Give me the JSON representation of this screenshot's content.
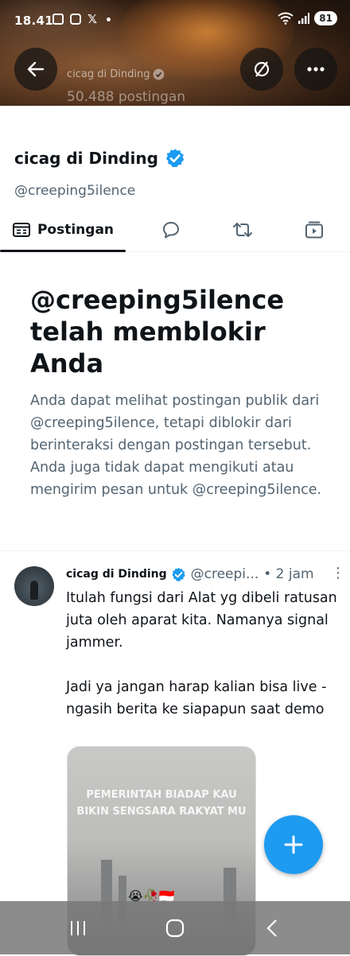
{
  "status_bar": {
    "time": "18.41",
    "x_label": "𝕏",
    "battery": "81"
  },
  "header": {
    "name": "cicag di Dinding",
    "post_count": "50.488 postingan"
  },
  "profile": {
    "name": "cicag di Dinding",
    "handle": "@creeping5ilence"
  },
  "tabs": [
    {
      "label": "Postingan",
      "icon": "posts-icon",
      "active": true
    },
    {
      "label": "",
      "icon": "reply-icon"
    },
    {
      "label": "",
      "icon": "repost-icon"
    },
    {
      "label": "",
      "icon": "media-icon"
    }
  ],
  "blocked": {
    "title": "@creeping5ilence telah memblokir Anda",
    "body": "Anda dapat melihat postingan publik dari @creeping5ilence, tetapi diblokir dari berinteraksi dengan postingan tersebut. Anda juga tidak dapat mengikuti atau mengirim pesan untuk @creeping5ilence."
  },
  "tweet": {
    "name": "cicag di Dinding",
    "handle": "@creepi...",
    "time": "• 2 jam",
    "more": "⋮",
    "text": "Itulah fungsi dari Alat yg dibeli ratusan juta oleh aparat kita. Namanya signal jammer.\n\nJadi ya jangan harap kalian bisa live - ngasih berita ke siapapun saat demo",
    "media_caption": "PEMERINTAH BIADAP KAU BIKIN SENGSARA RAKYAT MU",
    "media_emoji": "😭🥀🇮🇩"
  },
  "colors": {
    "accent": "#1d9bf0",
    "text": "#0f1419",
    "muted": "#536471"
  }
}
